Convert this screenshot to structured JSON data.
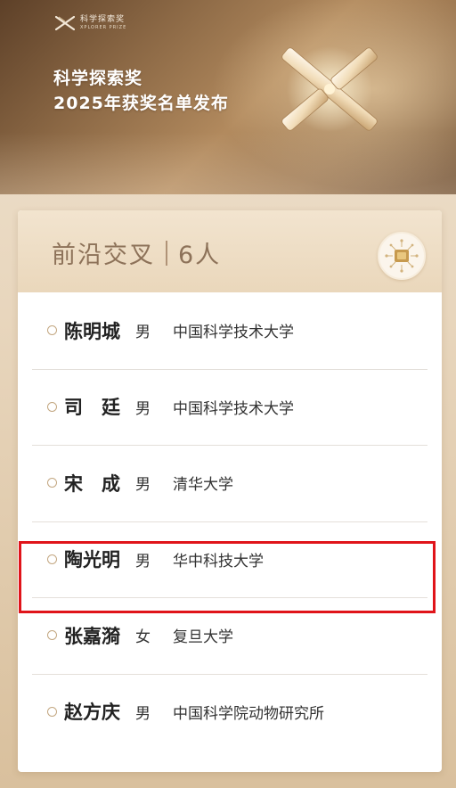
{
  "banner": {
    "logo_cn": "科学探索奖",
    "logo_en": "XPLORER PRIZE",
    "headline_line1": "科学探索奖",
    "headline_line2": "2025年获奖名单发布"
  },
  "card": {
    "category": "前沿交叉",
    "count": "6人",
    "badge_icon": "chip-icon"
  },
  "winners": [
    {
      "name": "陈明城",
      "gender": "男",
      "institution": "中国科学技术大学"
    },
    {
      "name": "司　廷",
      "gender": "男",
      "institution": "中国科学技术大学"
    },
    {
      "name": "宋　成",
      "gender": "男",
      "institution": "清华大学"
    },
    {
      "name": "陶光明",
      "gender": "男",
      "institution": "华中科技大学"
    },
    {
      "name": "张嘉漪",
      "gender": "女",
      "institution": "复旦大学"
    },
    {
      "name": "赵方庆",
      "gender": "男",
      "institution": "中国科学院动物研究所"
    }
  ],
  "colors": {
    "highlight": "#e0141a",
    "title": "#8d7259",
    "gold": "#c3a781"
  }
}
